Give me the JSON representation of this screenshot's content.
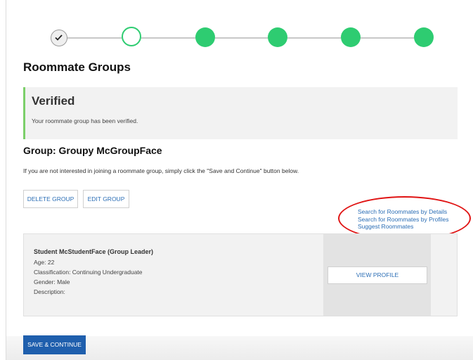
{
  "stepper": {
    "accent_color": "#2ecc71",
    "steps": [
      {
        "state": "completed",
        "icon": "checkmark-icon"
      },
      {
        "state": "current"
      },
      {
        "state": "upcoming"
      },
      {
        "state": "upcoming"
      },
      {
        "state": "upcoming"
      },
      {
        "state": "upcoming"
      }
    ]
  },
  "page": {
    "title": "Roommate Groups"
  },
  "alert": {
    "title": "Verified",
    "message": "Your roommate group has been verified.",
    "accent_color": "#7ccf6a"
  },
  "group": {
    "title": "Group: Groupy McGroupFace",
    "info": "If you are not interested in joining a roommate group, simply click the \"Save and Continue\" button below.",
    "delete_label": "DELETE GROUP",
    "edit_label": "EDIT GROUP"
  },
  "search_links": [
    "Search for Roommates by Details",
    "Search for Roommates by Profiles",
    "Suggest Roommates"
  ],
  "highlight_color": "#e01414",
  "member": {
    "name": "Student McStudentFace (Group Leader)",
    "age": "Age: 22",
    "classification": "Classification: Continuing Undergraduate",
    "gender": "Gender: Male",
    "description": "Description:",
    "view_profile_label": "VIEW PROFILE"
  },
  "footer": {
    "save_label": "SAVE & CONTINUE",
    "button_color": "#1f5fad"
  }
}
